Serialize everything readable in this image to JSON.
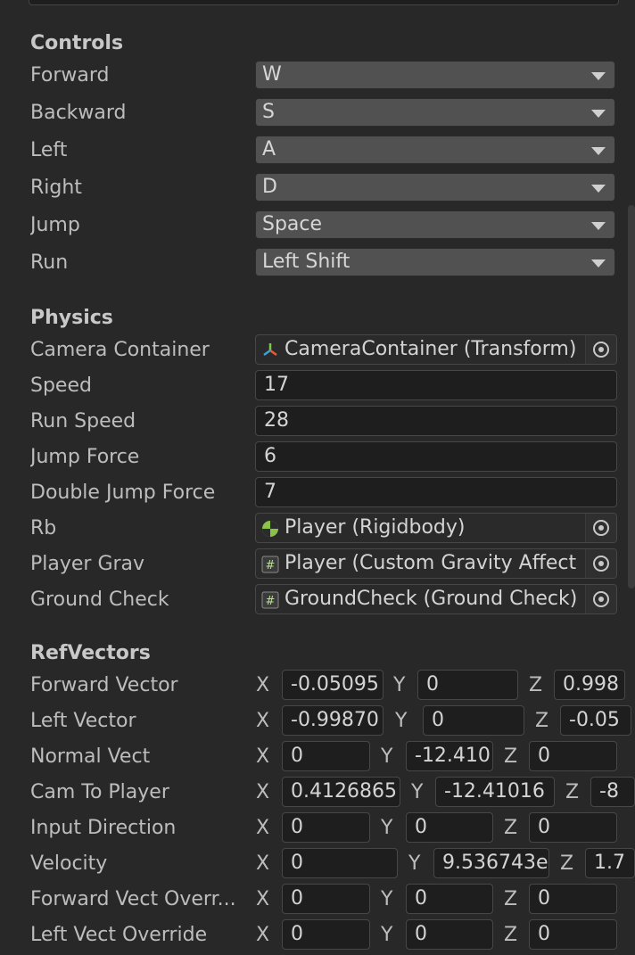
{
  "controls": {
    "header": "Controls",
    "rows": [
      {
        "label": "Forward",
        "value": "W"
      },
      {
        "label": "Backward",
        "value": "S"
      },
      {
        "label": "Left",
        "value": "A"
      },
      {
        "label": "Right",
        "value": "D"
      },
      {
        "label": "Jump",
        "value": "Space"
      },
      {
        "label": "Run",
        "value": "Left Shift"
      }
    ]
  },
  "physics": {
    "header": "Physics",
    "camera_container": {
      "label": "Camera Container",
      "value": "CameraContainer (Transform)",
      "icon": "transform-icon"
    },
    "speed": {
      "label": "Speed",
      "value": "17"
    },
    "run_speed": {
      "label": "Run Speed",
      "value": "28"
    },
    "jump_force": {
      "label": "Jump Force",
      "value": "6"
    },
    "double_jump_force": {
      "label": "Double Jump Force",
      "value": "7"
    },
    "rb": {
      "label": "Rb",
      "value": "Player (Rigidbody)",
      "icon": "rigidbody-icon"
    },
    "player_grav": {
      "label": "Player Grav",
      "value": "Player (Custom Gravity Affect",
      "icon": "script-icon"
    },
    "ground_check": {
      "label": "Ground Check",
      "value": "GroundCheck (Ground Check)",
      "icon": "script-icon"
    }
  },
  "refvectors": {
    "header": "RefVectors",
    "axis_labels": {
      "x": "X",
      "y": "Y",
      "z": "Z"
    },
    "forward_vector": {
      "label": "Forward Vector",
      "x": "-0.05095",
      "y": "0",
      "z": "0.998"
    },
    "left_vector": {
      "label": "Left Vector",
      "x": "-0.99870",
      "y": "0",
      "z": "-0.05"
    },
    "normal_vect": {
      "label": "Normal Vect",
      "x": "0",
      "y": "-12.410",
      "z": "0"
    },
    "cam_to_player": {
      "label": "Cam To Player",
      "x": "0.4126865",
      "y": "-12.41016",
      "z": "-8"
    },
    "input_direction": {
      "label": "Input Direction",
      "x": "0",
      "y": "0",
      "z": "0"
    },
    "velocity": {
      "label": "Velocity",
      "x": "0",
      "y": "9.536743e",
      "z": "1.7"
    },
    "forward_vect_override": {
      "label": "Forward Vect Overr...",
      "x": "0",
      "y": "0",
      "z": "0"
    },
    "left_vect_override": {
      "label": "Left Vect Override",
      "x": "0",
      "y": "0",
      "z": "0"
    }
  }
}
